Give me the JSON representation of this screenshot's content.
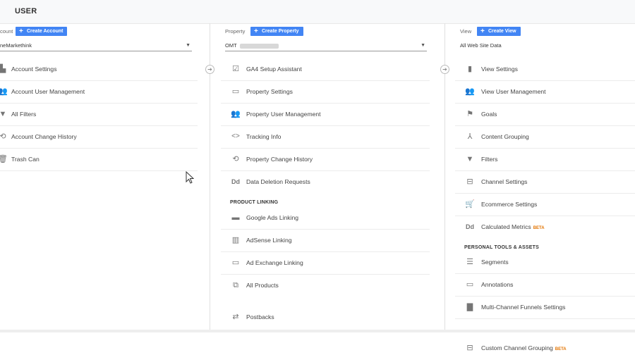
{
  "topbar": {
    "tab_label": "USER"
  },
  "account": {
    "label": "count",
    "create_label": "Create Account",
    "selected": "neMarkethink",
    "items": [
      {
        "label": "Account Settings",
        "icon": "building-icon"
      },
      {
        "label": "Account User Management",
        "icon": "people-icon"
      },
      {
        "label": "All Filters",
        "icon": "filter-icon"
      },
      {
        "label": "Account Change History",
        "icon": "history-icon"
      },
      {
        "label": "Trash Can",
        "icon": "trash-icon"
      }
    ]
  },
  "property": {
    "label": "Property",
    "create_label": "Create Property",
    "selected": "OMT",
    "items": [
      {
        "label": "GA4 Setup Assistant",
        "icon": "checkbox-icon"
      },
      {
        "label": "Property Settings",
        "icon": "window-icon"
      },
      {
        "label": "Property User Management",
        "icon": "people-icon"
      },
      {
        "label": "Tracking Info",
        "icon": "code-icon"
      },
      {
        "label": "Property Change History",
        "icon": "history-icon"
      },
      {
        "label": "Data Deletion Requests",
        "icon": "dd-icon"
      }
    ],
    "section_title": "PRODUCT LINKING",
    "linking_items": [
      {
        "label": "Google Ads Linking",
        "icon": "ads-icon"
      },
      {
        "label": "AdSense Linking",
        "icon": "adsense-icon"
      },
      {
        "label": "Ad Exchange Linking",
        "icon": "window-icon"
      },
      {
        "label": "All Products",
        "icon": "link-icon"
      },
      {
        "label": "Postbacks",
        "icon": "arrows-icon"
      }
    ]
  },
  "view": {
    "label": "View",
    "create_label": "Create View",
    "selected": "All Web Site Data",
    "items": [
      {
        "label": "View Settings",
        "icon": "document-icon"
      },
      {
        "label": "View User Management",
        "icon": "people-icon"
      },
      {
        "label": "Goals",
        "icon": "flag-icon"
      },
      {
        "label": "Content Grouping",
        "icon": "walk-icon"
      },
      {
        "label": "Filters",
        "icon": "filter-icon"
      },
      {
        "label": "Channel Settings",
        "icon": "channel-icon"
      },
      {
        "label": "Ecommerce Settings",
        "icon": "cart-icon"
      },
      {
        "label": "Calculated Metrics",
        "icon": "dd-icon",
        "badge": "BETA"
      }
    ],
    "section_title": "PERSONAL TOOLS & ASSETS",
    "tools_items": [
      {
        "label": "Segments",
        "icon": "segments-icon"
      },
      {
        "label": "Annotations",
        "icon": "comment-icon"
      },
      {
        "label": "Multi-Channel Funnels Settings",
        "icon": "bars-icon"
      },
      {
        "label": "Custom Channel Grouping",
        "icon": "channel-icon",
        "badge": "BETA"
      }
    ]
  }
}
